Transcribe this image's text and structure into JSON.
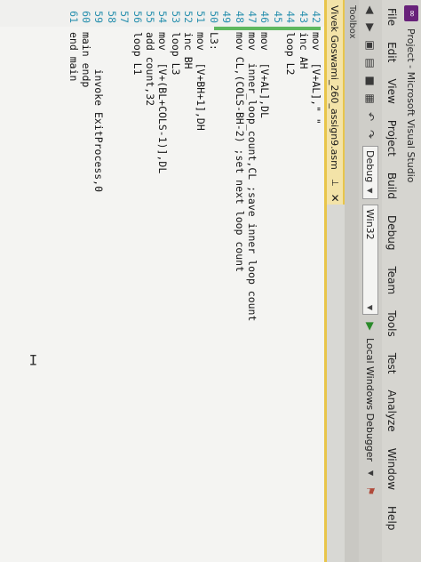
{
  "window": {
    "title": "Project - Microsoft Visual Studio"
  },
  "menu": [
    "File",
    "Edit",
    "View",
    "Project",
    "Build",
    "Debug",
    "Team",
    "Tools",
    "Test",
    "Analyze",
    "Window",
    "Help"
  ],
  "toolbar": {
    "config": "Debug",
    "platform": "Win32",
    "debugger": "Local Windows Debugger"
  },
  "toolbox_label": "Toolbox",
  "tab": {
    "title": "Vivek Goswami_260_assign9.asm"
  },
  "code_lines": [
    {
      "n": "42",
      "text": "mov  [V+AL],\" \""
    },
    {
      "n": "43",
      "text": "inc AH"
    },
    {
      "n": "44",
      "text": "loop L2"
    },
    {
      "n": "45",
      "text": ""
    },
    {
      "n": "46",
      "text": "mov  [V+AL],DL"
    },
    {
      "n": "47",
      "text": "mov  inner_loop_count,CL ;save inner loop count"
    },
    {
      "n": "48",
      "text": "mov CL,(COLS-BH-2) ;set next loop count"
    },
    {
      "n": "49",
      "text": ""
    },
    {
      "n": "50",
      "text": "L3:"
    },
    {
      "n": "51",
      "text": "mov  [V+BH+1],DH"
    },
    {
      "n": "52",
      "text": "inc BH"
    },
    {
      "n": "53",
      "text": "loop L3"
    },
    {
      "n": "54",
      "text": "mov  [V+(BL+COLS-1)],DL"
    },
    {
      "n": "55",
      "text": "add count,32"
    },
    {
      "n": "56",
      "text": "loop L1"
    },
    {
      "n": "57",
      "text": ""
    },
    {
      "n": "58",
      "text": ""
    },
    {
      "n": "59",
      "text": "      invoke ExitProcess,0"
    },
    {
      "n": "60",
      "text": "main endp"
    },
    {
      "n": "61",
      "text": "end main"
    }
  ]
}
